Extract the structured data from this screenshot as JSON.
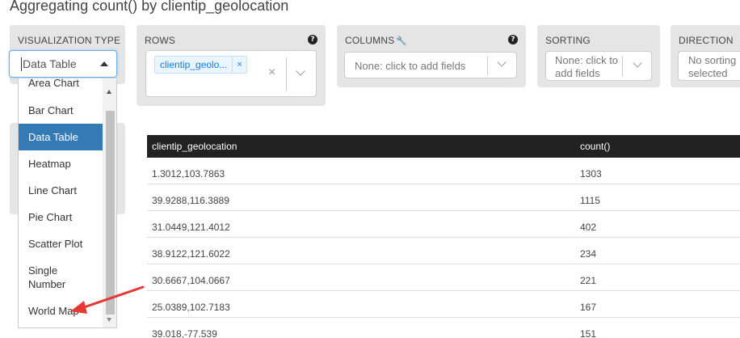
{
  "page_title": "Aggregating count() by clientip_geolocation",
  "visualization": {
    "label": "VISUALIZATION TYPE",
    "selected": "Data Table",
    "options": [
      "Area Chart",
      "Bar Chart",
      "Data Table",
      "Heatmap",
      "Line Chart",
      "Pie Chart",
      "Scatter Plot",
      "Single Number",
      "World Map"
    ]
  },
  "rows": {
    "label": "ROWS",
    "tag": "clientip_geolo...",
    "tag_remove": "×",
    "clear": "×"
  },
  "columns": {
    "label": "COLUMNS",
    "placeholder": "None: click to add fields"
  },
  "sorting": {
    "label": "SORTING",
    "placeholder_line1": "None: click to",
    "placeholder_line2": "add fields"
  },
  "direction": {
    "label": "DIRECTION",
    "placeholder_line1": "No sorting",
    "placeholder_line2": "selected"
  },
  "table": {
    "headers": [
      "clientip_geolocation",
      "count()"
    ],
    "rows": [
      [
        "1.3012,103.7863",
        "1303"
      ],
      [
        "39.9288,116.3889",
        "1115"
      ],
      [
        "31.0449,121.4012",
        "402"
      ],
      [
        "38.9122,121.6022",
        "234"
      ],
      [
        "30.6667,104.0667",
        "221"
      ],
      [
        "25.0389,102.7183",
        "167"
      ],
      [
        "39.018,-77.539",
        "151"
      ]
    ]
  },
  "colors": {
    "accent": "#337ab7",
    "annotation_arrow": "#e53935",
    "table_header": "#222222"
  }
}
